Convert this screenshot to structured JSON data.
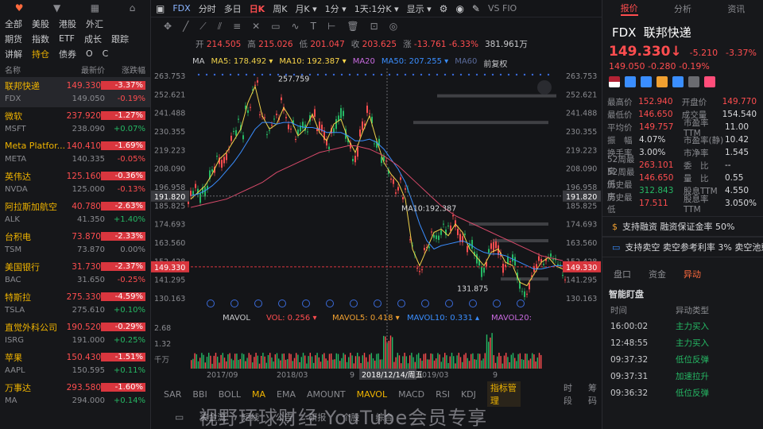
{
  "left": {
    "top_icons": [
      "heart-icon",
      "filter-icon",
      "grid-icon",
      "bookmark-icon"
    ],
    "market_tabs": [
      "全部",
      "美股",
      "港股",
      "外汇"
    ],
    "sub_tabs": [
      "指数",
      "ETF",
      "成长",
      "跟踪"
    ],
    "sub_tabs0": "期货",
    "tabs2": [
      "讲解",
      "持仓",
      "债券",
      "O",
      "C"
    ],
    "headers": {
      "name": "名称",
      "price": "最新价",
      "change": "涨跌幅"
    },
    "stocks": [
      {
        "name": "联邦快递",
        "ticker": "FDX",
        "price": "149.330",
        "change": "-3.37%",
        "post_price": "149.050",
        "post_change": "-0.19%",
        "post_dir": "neg"
      },
      {
        "name": "微软",
        "ticker": "MSFT",
        "price": "237.920",
        "change": "-1.27%",
        "post_price": "238.090",
        "post_change": "+0.07%",
        "post_dir": "pos"
      },
      {
        "name": "Meta Platfor...",
        "ticker": "META",
        "price": "140.410",
        "change": "-1.69%",
        "post_price": "140.335",
        "post_change": "-0.05%",
        "post_dir": "neg"
      },
      {
        "name": "英伟达",
        "ticker": "NVDA",
        "price": "125.160",
        "change": "-0.36%",
        "post_price": "125.000",
        "post_change": "-0.13%",
        "post_dir": "neg"
      },
      {
        "name": "阿拉斯加航空",
        "ticker": "ALK",
        "price": "40.780",
        "change": "-2.63%",
        "post_price": "41.350",
        "post_change": "+1.40%",
        "post_dir": "pos"
      },
      {
        "name": "台积电",
        "ticker": "TSM",
        "price": "73.870",
        "change": "-2.33%",
        "post_price": "73.870",
        "post_change": "0.00%",
        "post_dir": "flat"
      },
      {
        "name": "美国银行",
        "ticker": "BAC",
        "price": "31.730",
        "change": "-2.37%",
        "post_price": "31.650",
        "post_change": "-0.25%",
        "post_dir": "neg"
      },
      {
        "name": "特斯拉",
        "ticker": "TSLA",
        "price": "275.330",
        "change": "-4.59%",
        "post_price": "275.610",
        "post_change": "+0.10%",
        "post_dir": "pos"
      },
      {
        "name": "直觉外科公司",
        "ticker": "ISRG",
        "price": "190.520",
        "change": "-0.29%",
        "post_price": "191.000",
        "post_change": "+0.25%",
        "post_dir": "pos"
      },
      {
        "name": "苹果",
        "ticker": "AAPL",
        "price": "150.430",
        "change": "-1.51%",
        "post_price": "150.595",
        "post_change": "+0.11%",
        "post_dir": "pos"
      },
      {
        "name": "万事达",
        "ticker": "MA",
        "price": "293.580",
        "change": "-1.60%",
        "post_price": "294.000",
        "post_change": "+0.14%",
        "post_dir": "pos"
      }
    ]
  },
  "center": {
    "toolbar": {
      "symbol": "FDX",
      "items": [
        "分时",
        "多日",
        "日K",
        "周K",
        "月K ▾",
        "1分 ▾",
        "1天:1分K ▾",
        "显示 ▾"
      ],
      "active": "日K",
      "right_label": "VS FIO"
    },
    "ohlc": {
      "open_label": "开",
      "open": "214.505",
      "high_label": "高",
      "high": "215.026",
      "low_label": "低",
      "low": "201.047",
      "close_label": "收",
      "close": "203.625",
      "chg_label": "涨",
      "chg": "-13.761",
      "chg_pct": "-6.33%",
      "vol": "381.961万"
    },
    "ma_legend": {
      "ma": "MA",
      "ma5": "MA5: 178.492 ▾",
      "ma10": "MA10: 192.387 ▾",
      "ma20": "MA20",
      "ma50": "MA50: 207.255 ▾",
      "ma60": "MA60",
      "adj": "前复权"
    },
    "ma_colors": {
      "ma5": "#f0d24a",
      "ma10": "#4a9eff",
      "ma20": "#c86adf",
      "ma50": "#3a8eff",
      "ma60": "#d84a6a"
    },
    "vol_legend": {
      "label": "MAVOL",
      "vol": "VOL: 0.256 ▾",
      "mavol5": "MAVOL5: 0.418 ▾",
      "mavol10": "MAVOL10: 0.331 ▴",
      "mavol20": "MAVOL20:"
    },
    "bottom_tabs": [
      "SAR",
      "BBI",
      "BOLL",
      "MA",
      "EMA",
      "AMOUNT",
      "MAVOL",
      "MACD",
      "RSI",
      "KDJ",
      "指标管理",
      "时段",
      "筹码"
    ],
    "bottom_bar": [
      "资金流",
      "短线",
      "公告",
      "研报",
      "个股",
      "综合"
    ]
  },
  "chart_data": {
    "type": "line",
    "title": "",
    "y_ticks": [
      "263.753",
      "252.621",
      "241.488",
      "230.355",
      "219.223",
      "208.090",
      "196.958",
      "185.825",
      "174.693",
      "163.560",
      "152.428",
      "141.295",
      "130.163"
    ],
    "x_ticks": [
      "2017/09",
      "2018/03",
      "9",
      "2019/03",
      "9"
    ],
    "crosshair_x": "2018/12/14/周五",
    "crosshair_y": "191.820",
    "last_price_tag": "149.330",
    "annotations": [
      "257.759",
      "MA10:192.387",
      "131.875"
    ],
    "vol_ticks": [
      "2.68",
      "1.32",
      "千万"
    ],
    "ylim": [
      130.163,
      263.753
    ],
    "series": [
      {
        "name": "MA5",
        "color": "#f0d24a",
        "values": [
          190,
          194,
          198,
          205,
          214,
          218,
          225,
          232,
          248,
          257.7,
          240,
          232,
          235,
          245,
          238,
          228,
          232,
          241,
          230,
          225,
          235,
          238,
          226,
          218,
          230,
          240,
          225,
          212,
          205,
          200,
          190,
          160,
          150,
          160,
          170,
          172,
          168,
          175,
          170,
          160,
          155,
          150,
          158,
          160,
          152,
          150,
          140,
          138,
          145,
          152,
          155,
          150,
          148
        ]
      },
      {
        "name": "MA50",
        "color": "#3a8eff",
        "values": [
          192,
          193,
          195,
          198,
          202,
          207,
          212,
          218,
          225,
          232,
          236,
          236,
          235,
          236,
          236,
          234,
          233,
          233,
          232,
          230,
          230,
          230,
          228,
          225,
          225,
          226,
          224,
          220,
          214,
          208,
          200,
          188,
          175,
          165,
          160,
          162,
          163,
          164,
          165,
          163,
          160,
          158,
          157,
          157,
          156,
          154,
          152,
          150,
          148,
          148,
          149,
          150,
          150
        ]
      },
      {
        "name": "MA60",
        "color": "#d84a6a",
        "values": [
          185,
          186,
          187,
          188,
          189,
          190,
          192,
          194,
          196,
          198,
          200,
          203,
          206,
          208,
          210,
          212,
          214,
          216,
          218,
          219,
          220,
          221,
          222,
          222,
          221,
          220,
          218,
          216,
          213,
          210,
          206,
          202,
          198,
          194,
          190,
          186,
          183,
          180,
          178,
          176,
          174,
          172,
          170,
          168,
          166,
          164,
          162,
          160,
          158,
          156,
          155,
          154,
          153
        ]
      }
    ]
  },
  "right": {
    "tabs": [
      "报价",
      "分析",
      "资讯"
    ],
    "active_tab": "报价",
    "symbol": "FDX",
    "name": "联邦快递",
    "price": "149.330",
    "arrow": "↓",
    "change": "-5.210",
    "change_pct": "-3.37%",
    "post_price": "149.050",
    "post_change": "-0.280",
    "post_pct": "-0.19%",
    "stats": [
      {
        "k1": "最高价",
        "v1": "152.940",
        "c1": "neg",
        "k2": "开盘价",
        "v2": "149.770",
        "c2": "neg"
      },
      {
        "k1": "最低价",
        "v1": "146.650",
        "c1": "neg",
        "k2": "成交量",
        "v2": "154.540",
        "c2": "flat"
      },
      {
        "k1": "平均价",
        "v1": "149.757",
        "c1": "neg",
        "k2": "市盈率TTM",
        "v2": "11.00",
        "c2": "flat"
      },
      {
        "k1": "振　幅",
        "v1": "4.07%",
        "c1": "flat",
        "k2": "市盈率(静)",
        "v2": "10.42",
        "c2": "flat"
      },
      {
        "k1": "换手率",
        "v1": "3.00%",
        "c1": "flat",
        "k2": "市净率",
        "v2": "1.545",
        "c2": "flat"
      },
      {
        "k1": "52周最高",
        "v1": "263.101",
        "c1": "neg",
        "k2": "委　比",
        "v2": "--",
        "c2": "flat"
      },
      {
        "k1": "52周最低",
        "v1": "146.650",
        "c1": "neg",
        "k2": "量　比",
        "v2": "0.55",
        "c2": "flat"
      },
      {
        "k1": "历史最高",
        "v1": "312.843",
        "c1": "pos",
        "k2": "股息TTM",
        "v2": "4.550",
        "c2": "flat"
      },
      {
        "k1": "历史最低",
        "v1": "17.511",
        "c1": "neg",
        "k2": "股息率TTM",
        "v2": "3.050%",
        "c2": "flat"
      }
    ],
    "banner1": "支持融资 融资保证金率 50%",
    "banner2": "支持卖空 卖空参考利率 3% 卖空池剩",
    "tabs2": [
      "盘口",
      "资金",
      "异动"
    ],
    "active_tab2": "异动",
    "section": "智能盯盘",
    "evt_head": {
      "time": "时间",
      "type": "异动类型"
    },
    "events": [
      {
        "time": "16:00:02",
        "type": "主力买入",
        "dir": "green"
      },
      {
        "time": "12:48:55",
        "type": "主力买入",
        "dir": "green"
      },
      {
        "time": "09:37:32",
        "type": "低位反弹",
        "dir": "green"
      },
      {
        "time": "09:37:31",
        "type": "加速拉升",
        "dir": "green"
      },
      {
        "time": "09:36:32",
        "type": "低位反弹",
        "dir": "green"
      }
    ]
  },
  "watermark": "视野环球财经 YouTube会员专享"
}
